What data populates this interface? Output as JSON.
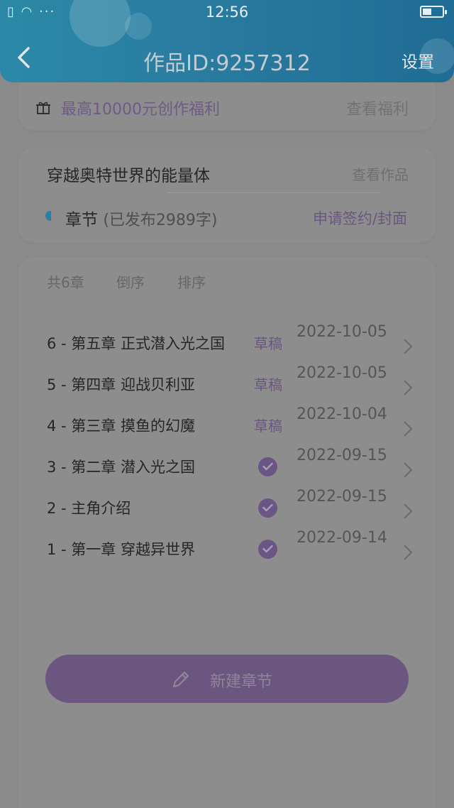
{
  "status_bar": {
    "left_icons": "▯ ◠ ···",
    "time": "12:56"
  },
  "header": {
    "title": "作品ID:9257312",
    "settings_label": "设置"
  },
  "benefit": {
    "text": "最高10000元创作福利",
    "link": "查看福利"
  },
  "work": {
    "title": "穿越奥特世界的能量体",
    "view_link": "查看作品",
    "chapter_label": "章节",
    "published": "(已发布2989字)",
    "sign_link": "申请签约/封面"
  },
  "chapter_list": {
    "count_label": "共6章",
    "reverse_label": "倒序",
    "sort_label": "排序",
    "rows": [
      {
        "name": "6 - 第五章  正式潜入光之国",
        "status": "草稿",
        "date": "2022-10-05"
      },
      {
        "name": "5 - 第四章  迎战贝利亚",
        "status": "草稿",
        "date": "2022-10-05"
      },
      {
        "name": "4 - 第三章  摸鱼的幻魔",
        "status": "草稿",
        "date": "2022-10-04"
      },
      {
        "name": "3 - 第二章  潜入光之国",
        "status": "",
        "date": "2022-09-15"
      },
      {
        "name": "2 - 主角介绍",
        "status": "",
        "date": "2022-09-15"
      },
      {
        "name": "1 - 第一章  穿越异世界",
        "status": "",
        "date": "2022-09-14"
      }
    ]
  },
  "new_chapter_button": {
    "label": "新建章节"
  },
  "colors": {
    "header_blue": "#2a7ba0",
    "accent_purple": "#6b567f",
    "overlay_gray": "#8a8a8a"
  },
  "icons": [
    "back-arrow-icon",
    "gift-icon",
    "check-icon",
    "chevron-right-icon",
    "pencil-icon",
    "battery-icon"
  ]
}
